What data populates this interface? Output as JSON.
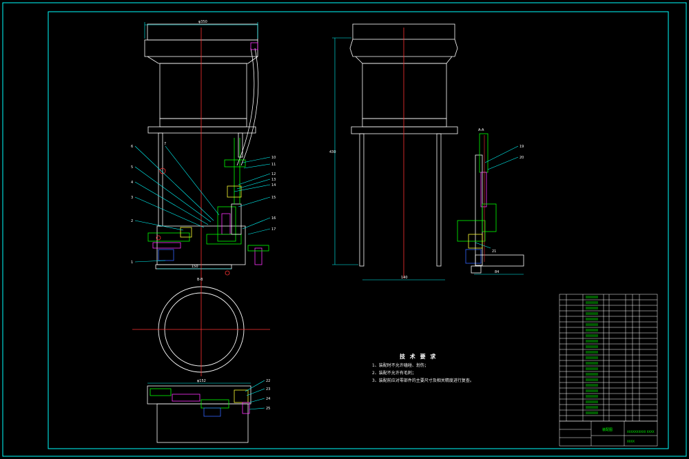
{
  "drawing": {
    "colors": {
      "background": "#000000",
      "frame": "#00ffff",
      "outline": "#ffffff",
      "centerline": "#ff3333",
      "part_green": "#00ff00",
      "part_magenta": "#ff33ff",
      "part_yellow": "#ffff33",
      "part_blue": "#3366ff"
    },
    "dimensions": {
      "top_width": "φ350",
      "base_width_front": "150",
      "side_height": "430",
      "side_base_width": "140",
      "side_small_width": "84",
      "bottom_width": "φ152"
    },
    "section_labels": {
      "top_section": "A-A",
      "mid_section": "B-B",
      "side_section": "A-A"
    },
    "front_leaders": [
      "6",
      "7",
      "5",
      "4",
      "3",
      "2",
      "1"
    ],
    "right_leaders": [
      "10",
      "11",
      "12",
      "13",
      "14",
      "15",
      "16",
      "17",
      "18"
    ],
    "side_leaders": [
      "19",
      "20",
      "21"
    ],
    "bottom_leaders": [
      "22",
      "23",
      "24",
      "25"
    ],
    "tech_notes": {
      "title": "技 术 要 求",
      "lines": [
        "1、装配时不允许磕碰、划伤；",
        "2、装配不允许有毛刺；",
        "3、装配前应对零部件的主要尺寸及相关精度进行复查。"
      ]
    },
    "title_block": {
      "drawing_name": "装配图",
      "school": "XXXXXXXXXX XXXX",
      "code": "XXXX"
    }
  }
}
